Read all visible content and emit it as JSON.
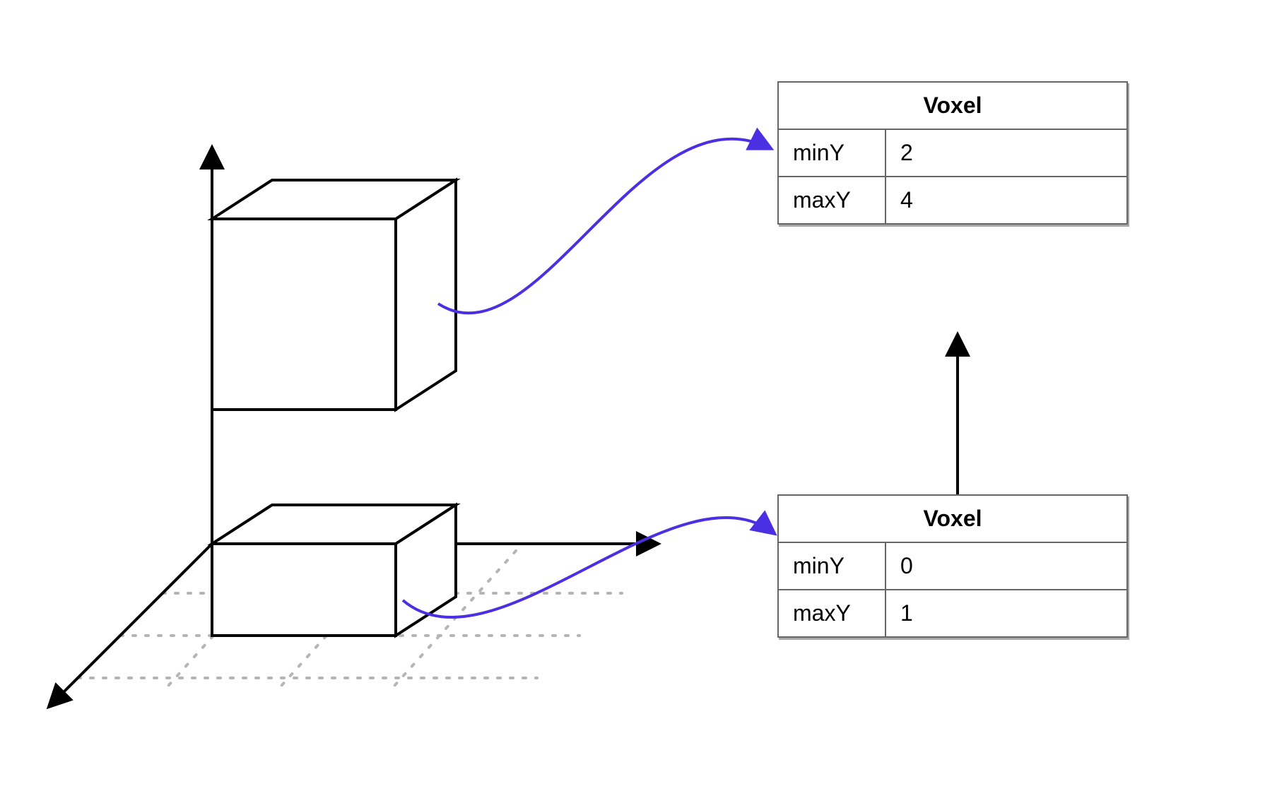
{
  "tables": {
    "top": {
      "title": "Voxel",
      "rows": [
        {
          "key": "minY",
          "val": "2"
        },
        {
          "key": "maxY",
          "val": "4"
        }
      ]
    },
    "bottom": {
      "title": "Voxel",
      "rows": [
        {
          "key": "minY",
          "val": "0"
        },
        {
          "key": "maxY",
          "val": "1"
        }
      ]
    }
  },
  "colors": {
    "curve": "#4B2FE3",
    "grid": "#B5B5B5",
    "stroke": "#000000"
  }
}
